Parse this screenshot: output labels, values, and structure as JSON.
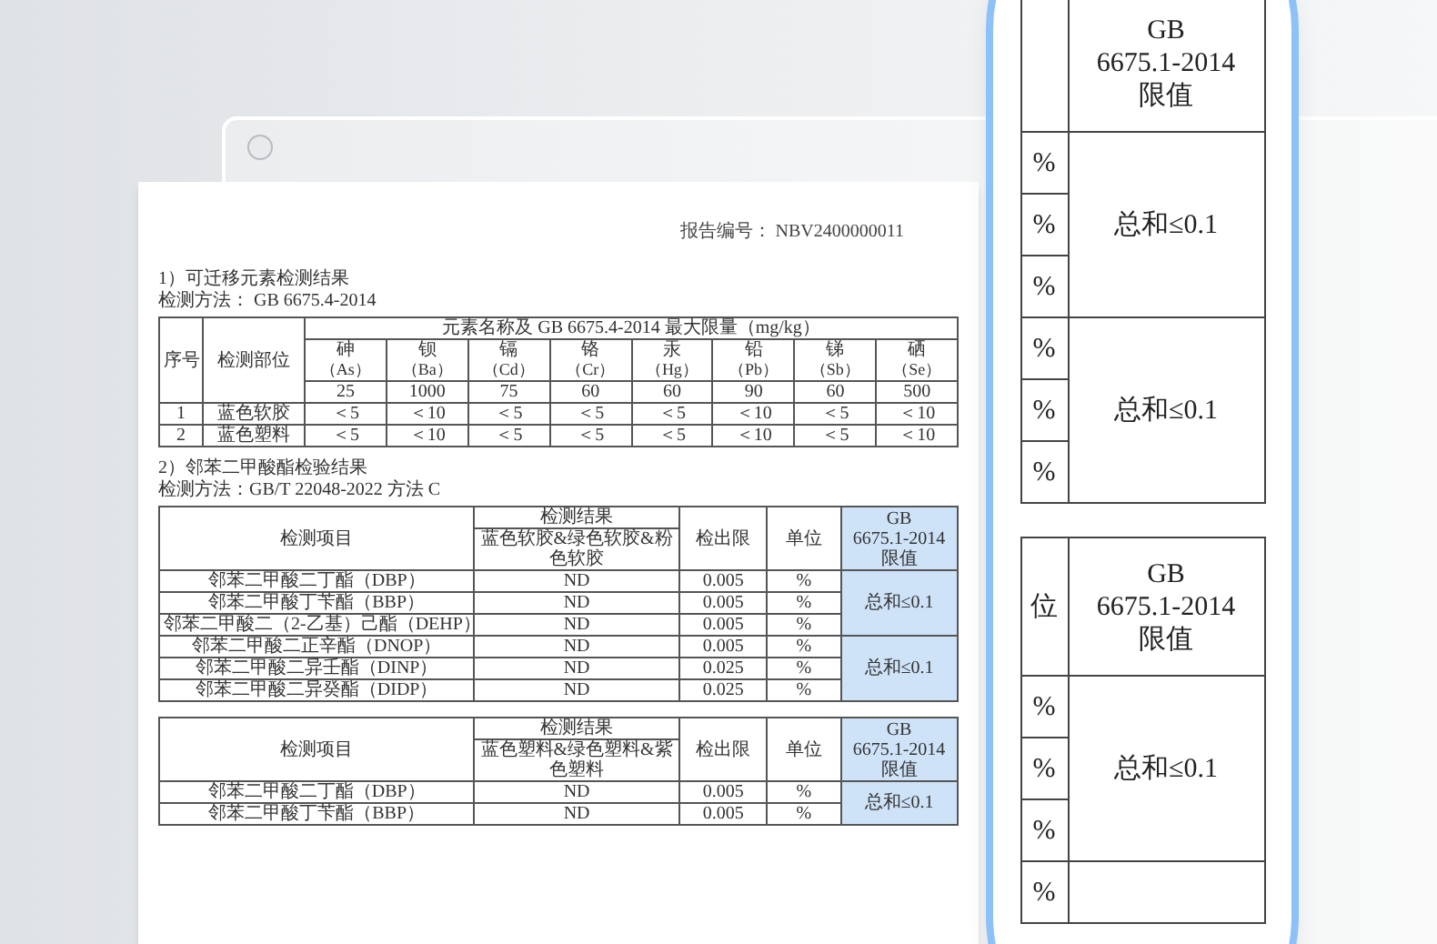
{
  "report": {
    "number_label": "报告编号：",
    "number": "NBV2400000011"
  },
  "section1": {
    "title": "1）可迁移元素检测结果",
    "method": "检测方法： GB 6675.4-2014",
    "no_header": "序号",
    "part_header": "检测部位",
    "group_header": "元素名称及 GB 6675.4-2014 最大限量（mg/kg）",
    "elements": [
      {
        "name": "砷",
        "symbol": "（As）",
        "limit": "25"
      },
      {
        "name": "钡",
        "symbol": "（Ba）",
        "limit": "1000"
      },
      {
        "name": "镉",
        "symbol": "（Cd）",
        "limit": "75"
      },
      {
        "name": "铬",
        "symbol": "（Cr）",
        "limit": "60"
      },
      {
        "name": "汞",
        "symbol": "（Hg）",
        "limit": "60"
      },
      {
        "name": "铅",
        "symbol": "（Pb）",
        "limit": "90"
      },
      {
        "name": "锑",
        "symbol": "（Sb）",
        "limit": "60"
      },
      {
        "name": "硒",
        "symbol": "（Se）",
        "limit": "500"
      }
    ],
    "rows": [
      {
        "no": "1",
        "part": "蓝色软胶",
        "values": [
          "＜5",
          "＜10",
          "＜5",
          "＜5",
          "＜5",
          "＜10",
          "＜5",
          "＜10"
        ]
      },
      {
        "no": "2",
        "part": "蓝色塑料",
        "values": [
          "＜5",
          "＜10",
          "＜5",
          "＜5",
          "＜5",
          "＜10",
          "＜5",
          "＜10"
        ]
      }
    ]
  },
  "section2": {
    "title": "2）邻苯二甲酸酯检验结果",
    "method": "检测方法：GB/T 22048-2022 方法 C",
    "tables": [
      {
        "item_header": "检测项目",
        "result_header": "检测结果",
        "result_subheader": "蓝色软胶&绿色软胶&粉色软胶",
        "limit_header": "检出限",
        "unit_header": "单位",
        "standard_header": [
          "GB",
          "6675.1-2014",
          "限值"
        ],
        "rows": [
          {
            "item": "邻苯二甲酸二丁酯（DBP）",
            "result": "ND",
            "detection_limit": "0.005",
            "unit": "%"
          },
          {
            "item": "邻苯二甲酸丁苄酯（BBP）",
            "result": "ND",
            "detection_limit": "0.005",
            "unit": "%"
          },
          {
            "item": "邻苯二甲酸二（2-乙基）己酯（DEHP）",
            "result": "ND",
            "detection_limit": "0.005",
            "unit": "%"
          },
          {
            "item": "邻苯二甲酸二正辛酯（DNOP）",
            "result": "ND",
            "detection_limit": "0.005",
            "unit": "%"
          },
          {
            "item": "邻苯二甲酸二异壬酯（DINP）",
            "result": "ND",
            "detection_limit": "0.025",
            "unit": "%"
          },
          {
            "item": "邻苯二甲酸二异癸酯（DIDP）",
            "result": "ND",
            "detection_limit": "0.025",
            "unit": "%"
          }
        ],
        "standard_values": [
          "总和≤0.1",
          "总和≤0.1"
        ]
      },
      {
        "item_header": "检测项目",
        "result_header": "检测结果",
        "result_subheader": "蓝色塑料&绿色塑料&紫色塑料",
        "limit_header": "检出限",
        "unit_header": "单位",
        "standard_header": [
          "GB",
          "6675.1-2014",
          "限值"
        ],
        "rows": [
          {
            "item": "邻苯二甲酸二丁酯（DBP）",
            "result": "ND",
            "detection_limit": "0.005",
            "unit": "%"
          },
          {
            "item": "邻苯二甲酸丁苄酯（BBP）",
            "result": "ND",
            "detection_limit": "0.005",
            "unit": "%"
          }
        ],
        "standard_values": [
          "总和≤0.1"
        ]
      }
    ]
  },
  "magnifier": {
    "groups": [
      {
        "limit_header": [
          "GB",
          "6675.1-2014",
          "限值"
        ],
        "units": [
          "%",
          "%",
          "%",
          "%",
          "%",
          "%"
        ],
        "limits": [
          "总和≤0.1",
          "总和≤0.1"
        ]
      },
      {
        "unit_header": "位",
        "limit_header": [
          "GB",
          "6675.1-2014",
          "限值"
        ],
        "units": [
          "%",
          "%",
          "%",
          "%"
        ],
        "limits": [
          "总和≤0.1"
        ]
      }
    ]
  }
}
